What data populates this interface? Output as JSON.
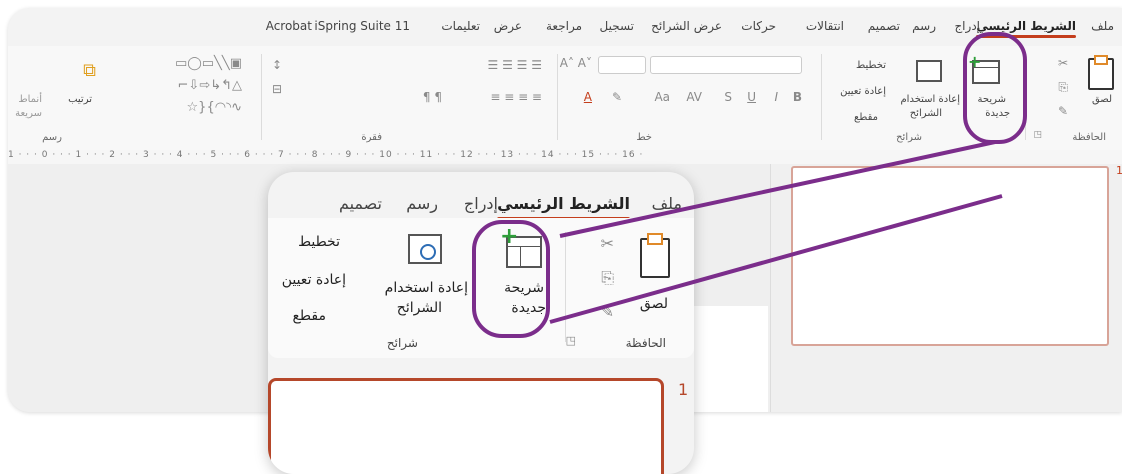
{
  "tabs": [
    "ملف",
    "الشريط الرئيسي",
    "إدراج",
    "رسم",
    "تصميم",
    "انتقالات",
    "حركات",
    "عرض الشرائح",
    "تسجيل",
    "مراجعة",
    "عرض",
    "تعليمات",
    "iSpring Suite 11",
    "Acrobat"
  ],
  "ribbon": {
    "clipboard": {
      "paste": "لصق",
      "label": "الحافظة"
    },
    "slides": {
      "new_slide_1": "شريحة",
      "new_slide_2": "جديدة",
      "reuse_1": "إعادة استخدام",
      "reuse_2": "الشرائح",
      "layout": "تخطيط",
      "reset": "إعادة تعيين",
      "section": "مقطع",
      "label": "شرائح"
    },
    "font": {
      "label": "خط",
      "bold": "B",
      "italic": "I",
      "underline": "U",
      "strike": "S"
    },
    "paragraph": {
      "label": "فقرة"
    },
    "drawing": {
      "label": "رسم",
      "arrange": "ترتيب",
      "styles_1": "أنماط",
      "styles_2": "سريعة"
    }
  },
  "ruler": "1 · · · 0 · · · 1 · · · 2 · · · 3 · · · 4 · · · 5 · · · 6 · · · 7 · · · 8 · · · 9 · · · 10 · · · 11 · · · 12 · · · 13 · · · 14 · · · 15 · · · 16 ·",
  "slide_number": "1",
  "zoom": {
    "tabs": [
      "ملف",
      "الشريط الرئيسي",
      "إدراج",
      "رسم",
      "تصميم"
    ],
    "paste": "لصق",
    "clipboard": "الحافظة",
    "new_slide_1": "شريحة",
    "new_slide_2": "جديدة",
    "reuse_1": "إعادة استخدام",
    "reuse_2": "الشرائح",
    "layout": "تخطيط",
    "reset": "إعادة تعيين",
    "section": "مقطع",
    "slides": "شرائح",
    "slide_number": "1"
  },
  "colors": {
    "accent": "#c43e1c",
    "highlight": "#7b2d8b",
    "slide_border": "#b5472a"
  }
}
